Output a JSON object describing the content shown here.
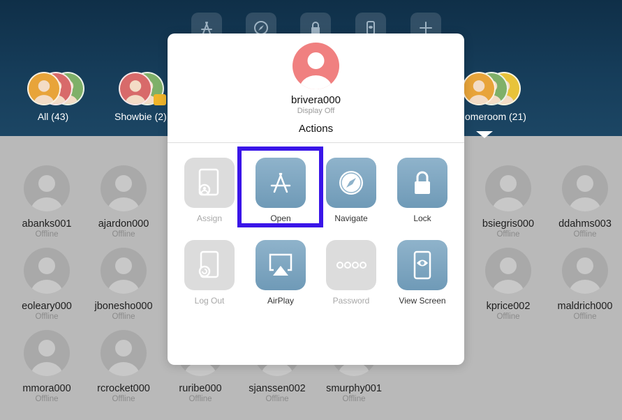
{
  "groups": [
    {
      "label": "All (43)"
    },
    {
      "label": "Showbie (2)"
    },
    {
      "label": "omeroom (21)"
    }
  ],
  "students": [
    {
      "name": "abanks001",
      "status": "Offline"
    },
    {
      "name": "ajardon000",
      "status": "Offline"
    },
    {
      "name": "bsiegris000",
      "status": "Offline"
    },
    {
      "name": "ddahms003",
      "status": "Offline"
    },
    {
      "name": "eoleary000",
      "status": "Offline"
    },
    {
      "name": "jbonesho000",
      "status": "Offline"
    },
    {
      "name": "kprice002",
      "status": "Offline"
    },
    {
      "name": "maldrich000",
      "status": "Offline"
    },
    {
      "name": "mmora000",
      "status": "Offline"
    },
    {
      "name": "rcrocket000",
      "status": "Offline"
    },
    {
      "name": "ruribe000",
      "status": "Offline"
    },
    {
      "name": "sjanssen002",
      "status": "Offline"
    },
    {
      "name": "smurphy001",
      "status": "Offline"
    }
  ],
  "popover": {
    "user_name": "brivera000",
    "user_status": "Display Off",
    "title": "Actions",
    "actions": [
      {
        "label": "Assign",
        "icon": "assign-icon",
        "enabled": false
      },
      {
        "label": "Open",
        "icon": "app-store-icon",
        "enabled": true
      },
      {
        "label": "Navigate",
        "icon": "compass-icon",
        "enabled": true
      },
      {
        "label": "Lock",
        "icon": "lock-icon",
        "enabled": true
      },
      {
        "label": "Log Out",
        "icon": "logout-icon",
        "enabled": false
      },
      {
        "label": "AirPlay",
        "icon": "airplay-icon",
        "enabled": true
      },
      {
        "label": "Password",
        "icon": "password-icon",
        "enabled": false
      },
      {
        "label": "View Screen",
        "icon": "view-screen-icon",
        "enabled": true
      }
    ]
  },
  "colors": {
    "header_bg": "#163d5a",
    "tile_active": "#7ea6c1",
    "tile_disabled": "#dcdcdc",
    "highlight_box": "#3a15e8",
    "avatar_selected": "#f08080"
  }
}
